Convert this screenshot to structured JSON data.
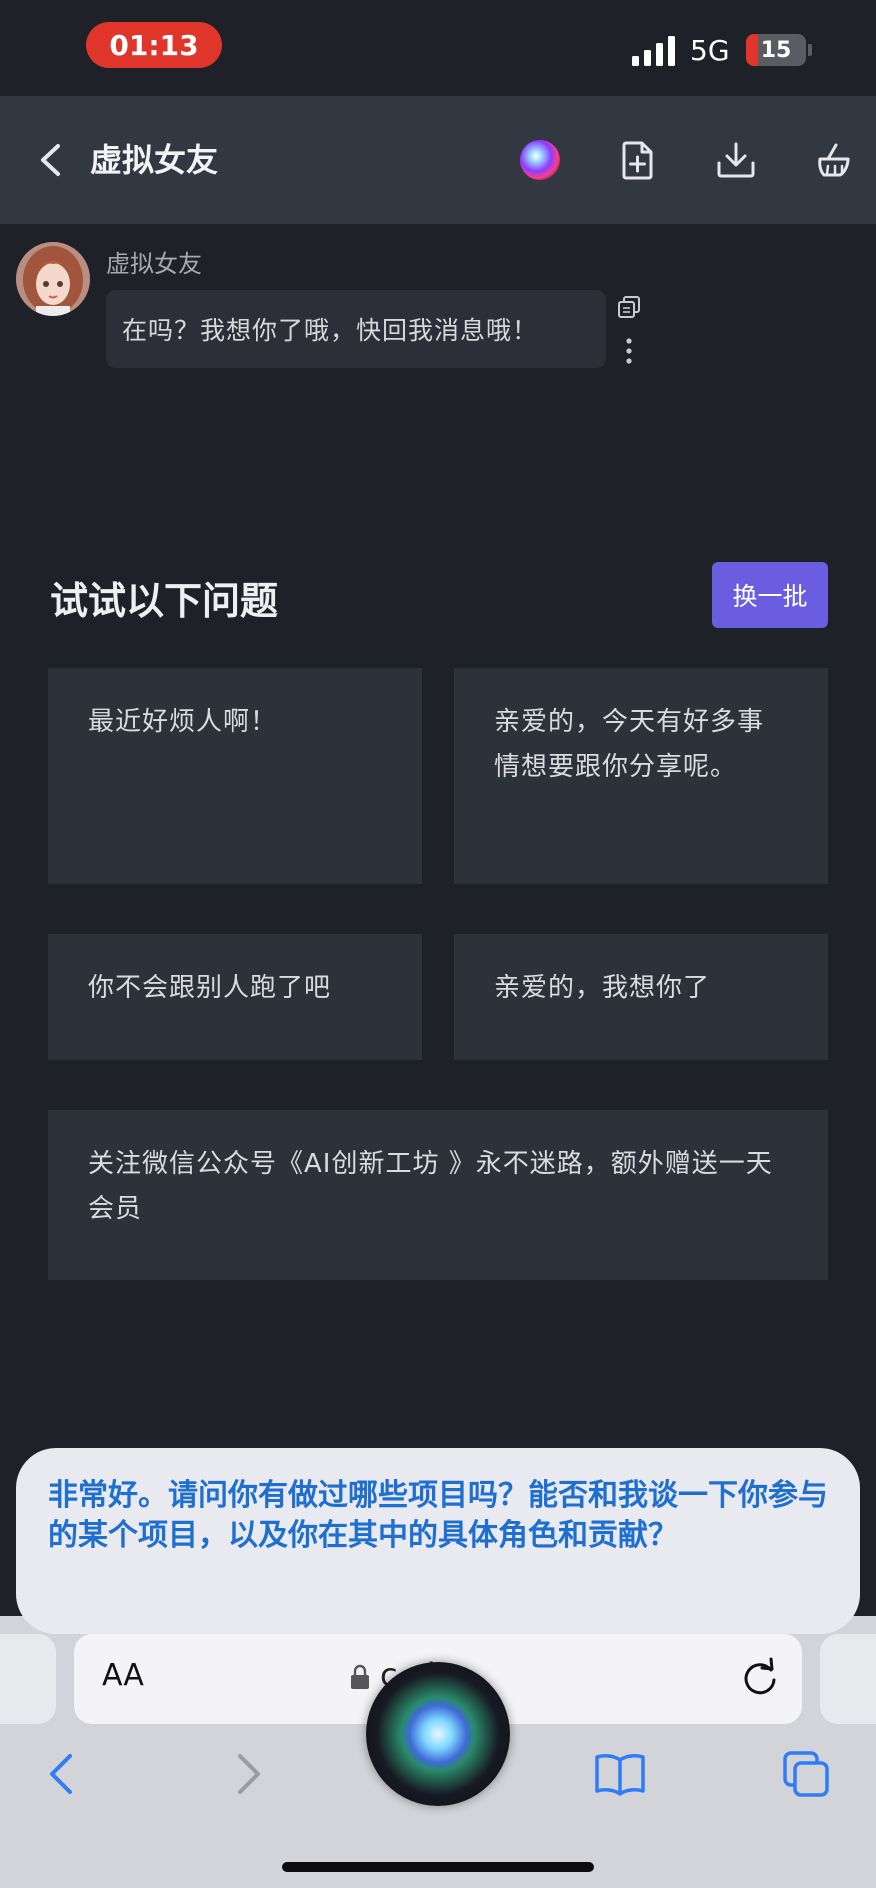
{
  "status_bar": {
    "time": "01:13",
    "network": "5G",
    "battery": "15"
  },
  "header": {
    "title": "虚拟女友"
  },
  "message": {
    "sender": "虚拟女友",
    "text": "在吗？我想你了哦，快回我消息哦！"
  },
  "suggestions": {
    "title": "试试以下问题",
    "refresh_label": "换一批",
    "cards": [
      "最近好烦人啊！",
      "亲爱的，今天有好多事情想要跟你分享呢。",
      "你不会跟别人跑了吧",
      "亲爱的，我想你了",
      "关注微信公众号《AI创新工坊 》永不迷路，额外赠送一天会员"
    ]
  },
  "siri": {
    "text": "非常好。请问你有做过哪些项目吗？能否和我谈一下你参与的某个项目，以及你在其中的具体角色和贡献？"
  },
  "browser": {
    "aa_label": "AA",
    "url": "c  vip"
  },
  "colors": {
    "background": "#1f2128",
    "header": "#323742",
    "accent": "#6a5de0",
    "siri_text": "#1e6fd0",
    "time_pill": "#e0352b"
  }
}
